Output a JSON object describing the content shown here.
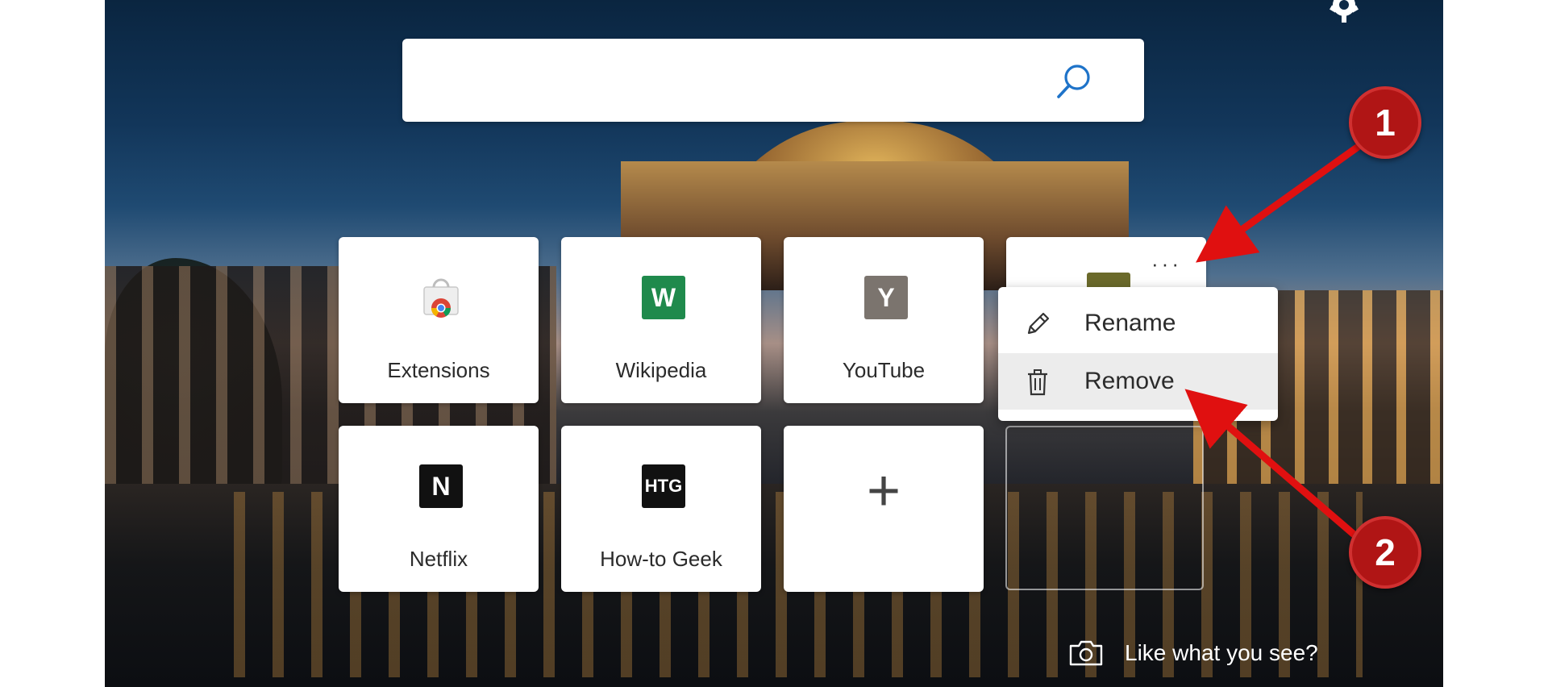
{
  "search": {
    "value": "",
    "placeholder": ""
  },
  "tiles": [
    {
      "label": "Extensions"
    },
    {
      "label": "Wikipedia",
      "glyph": "W",
      "color": "#1f8a4c"
    },
    {
      "label": "YouTube",
      "glyph": "Y",
      "color": "#7b746e"
    },
    {
      "label": "Netflix",
      "glyph": "N",
      "color": "#111111"
    },
    {
      "label": "How-to Geek",
      "glyph": "HTG",
      "color": "#111111"
    }
  ],
  "tile_more": {
    "dots": "···"
  },
  "context_menu": {
    "items": [
      {
        "label": "Rename",
        "icon": "pencil-icon"
      },
      {
        "label": "Remove",
        "icon": "trash-icon",
        "highlighted": true
      }
    ]
  },
  "annotations": [
    {
      "number": "1"
    },
    {
      "number": "2"
    }
  ],
  "footer": {
    "text": "Like what you see?",
    "icon": "camera-icon"
  },
  "colors": {
    "annotation_red": "#b01515",
    "arrow_red": "#e01010"
  }
}
